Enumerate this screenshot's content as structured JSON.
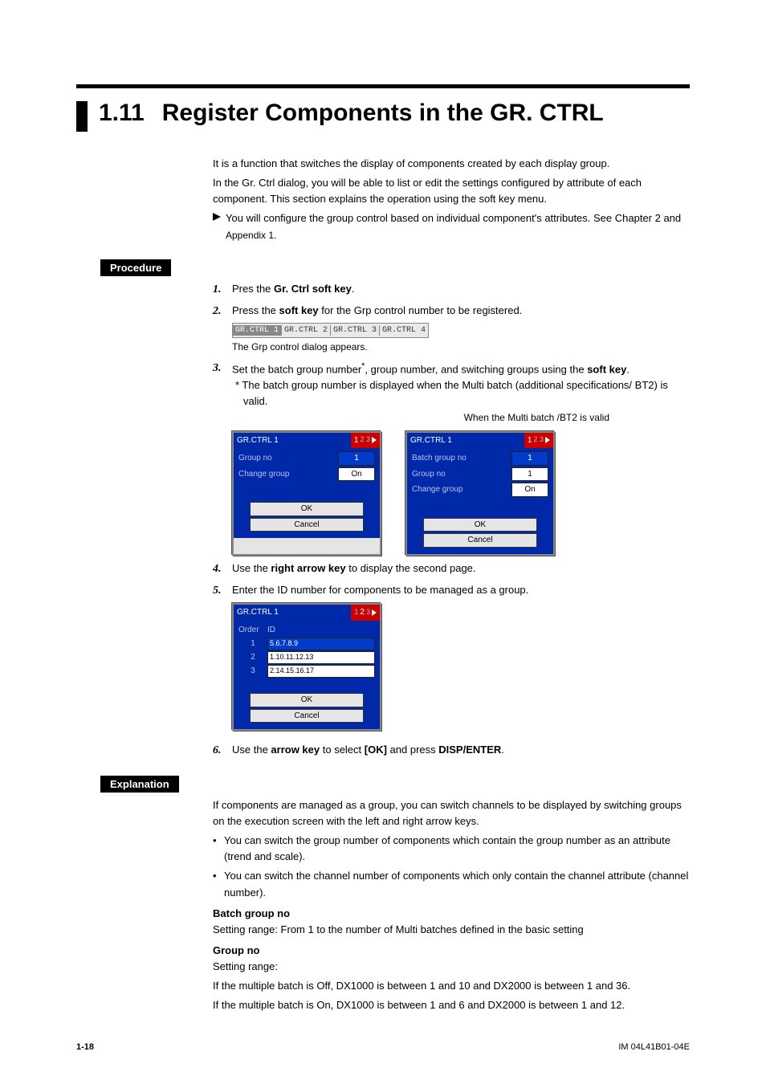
{
  "section_number": "1.11",
  "section_title": "Register Components in the GR. CTRL",
  "intro": {
    "p1": "It is a function that switches the display of components created by each display group.",
    "p2": "In the Gr. Ctrl dialog, you will be able to list or edit the settings configured by attribute of each component. This section explains the operation using the soft key menu.",
    "p3a": "You will configure the group control based on individual component's attributes. See Chapter 2 and ",
    "p3b": "Appendix 1.",
    "p3c": ""
  },
  "procedure_label": "Procedure",
  "steps": {
    "s1a": "Pres the ",
    "s1b": "Gr. Ctrl soft key",
    "s1c": ".",
    "s2a": "Press the ",
    "s2b": "soft key",
    "s2c": " for the Grp control number to be registered.",
    "s2_note": "The Grp control dialog appears.",
    "softkeys": {
      "k1": "GR.CTRL 1",
      "k2": "GR.CTRL 2",
      "k3": "GR.CTRL 3",
      "k4": "GR.CTRL 4"
    },
    "s3a": "Set the batch group number",
    "s3sup": "*",
    "s3b": ", group number, and switching groups using the ",
    "s3c": "soft key",
    "s3d": ".",
    "s3_star": "*  The batch group number is displayed when the Multi batch (additional specifications/ BT2) is valid.",
    "dlg_caption": "When the Multi batch /BT2 is valid",
    "dlg1": {
      "title": "GR.CTRL 1",
      "page_cur": "1",
      "page_rest": "2 3",
      "rows": [
        {
          "label": "Group no",
          "val": "1",
          "sel": true
        },
        {
          "label": "Change group",
          "val": "On",
          "sel": false
        }
      ],
      "ok": "OK",
      "cancel": "Cancel"
    },
    "dlg2": {
      "title": "GR.CTRL 1",
      "page_cur": "1",
      "page_rest": "2 3",
      "rows": [
        {
          "label": "Batch group no",
          "val": "1",
          "sel": true
        },
        {
          "label": "Group no",
          "val": "1",
          "sel": false
        },
        {
          "label": "Change group",
          "val": "On",
          "sel": false
        }
      ],
      "ok": "OK",
      "cancel": "Cancel"
    },
    "s4a": "Use the ",
    "s4b": "right arrow key",
    "s4c": " to display the second page.",
    "s5": "Enter the ID number for components to be managed as a group.",
    "dlg3": {
      "title": "GR.CTRL 1",
      "page_pre": "1",
      "page_cur": "2",
      "page_rest": "3",
      "th1": "Order",
      "th2": "ID",
      "rows": [
        {
          "order": "1",
          "id": "5.6.7.8.9",
          "sel": true
        },
        {
          "order": "2",
          "id": "1.10.11.12.13",
          "sel": false
        },
        {
          "order": "3",
          "id": "2.14.15.16.17",
          "sel": false
        }
      ],
      "ok": "OK",
      "cancel": "Cancel"
    },
    "s6a": "Use the ",
    "s6b": "arrow key",
    "s6c": " to select ",
    "s6d": "[OK]",
    "s6e": " and press ",
    "s6f": "DISP/ENTER",
    "s6g": "."
  },
  "explanation_label": "Explanation",
  "explanation": {
    "p1": "If components are managed as a group, you can switch channels to be displayed by switching groups on the execution screen with the left and right arrow keys.",
    "b1": "You can switch the group number of components which contain the group number as an attribute (trend and scale).",
    "b2": "You can switch the channel number of components which only contain the channel attribute (channel number).",
    "h1": "Batch group no",
    "h1_line": "Setting range: From 1 to the number of Multi batches defined in the basic setting",
    "h2": "Group no",
    "h2_l1": "Setting range:",
    "h2_l2": "If the multiple batch is Off, DX1000 is between 1 and 10 and DX2000 is between 1 and 36.",
    "h2_l3": "If the multiple batch is On, DX1000 is between 1 and 6 and DX2000 is between 1 and 12."
  },
  "footer": {
    "page": "1-18",
    "doc": "IM 04L41B01-04E"
  }
}
